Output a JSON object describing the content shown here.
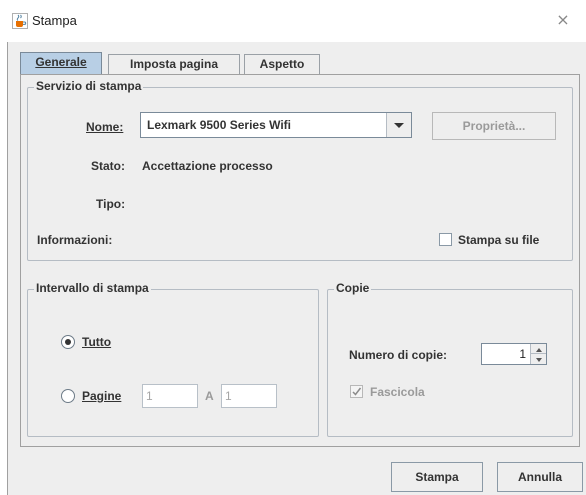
{
  "window": {
    "title": "Stampa",
    "close_glyph": "×"
  },
  "tabs": [
    {
      "label": "Generale",
      "active": true
    },
    {
      "label": "Imposta pagina",
      "active": false
    },
    {
      "label": "Aspetto",
      "active": false
    }
  ],
  "print_service": {
    "group_title": "Servizio di stampa",
    "name_label": "Nome:",
    "printer_name": "Lexmark 9500 Series Wifi",
    "properties_button": "Proprietà...",
    "status_label": "Stato:",
    "status_value": "Accettazione processo",
    "type_label": "Tipo:",
    "type_value": "",
    "info_label": "Informazioni:",
    "print_to_file_label": "Stampa su file",
    "print_to_file_checked": false
  },
  "print_range": {
    "group_title": "Intervallo di stampa",
    "all_label": "Tutto",
    "all_selected": true,
    "pages_label": "Pagine",
    "from_value": "1",
    "to_label": "A",
    "to_value": "1"
  },
  "copies": {
    "group_title": "Copie",
    "count_label": "Numero di copie:",
    "count_value": "1",
    "collate_label": "Fascicola",
    "collate_checked": true,
    "collate_enabled": false
  },
  "footer": {
    "print_button": "Stampa",
    "cancel_button": "Annulla"
  },
  "icons": {
    "app": "java-coffee-cup-icon",
    "close": "close-icon",
    "dropdown": "triangle-down-icon",
    "spin_up": "triangle-up-icon",
    "spin_down": "triangle-down-icon",
    "check": "check-mark-icon"
  },
  "colors": {
    "window_bg": "#eeeeee",
    "active_tab": "#b8cfe5",
    "border": "#a0a0a0",
    "text": "#333333",
    "disabled_text": "#9a9a9a"
  }
}
